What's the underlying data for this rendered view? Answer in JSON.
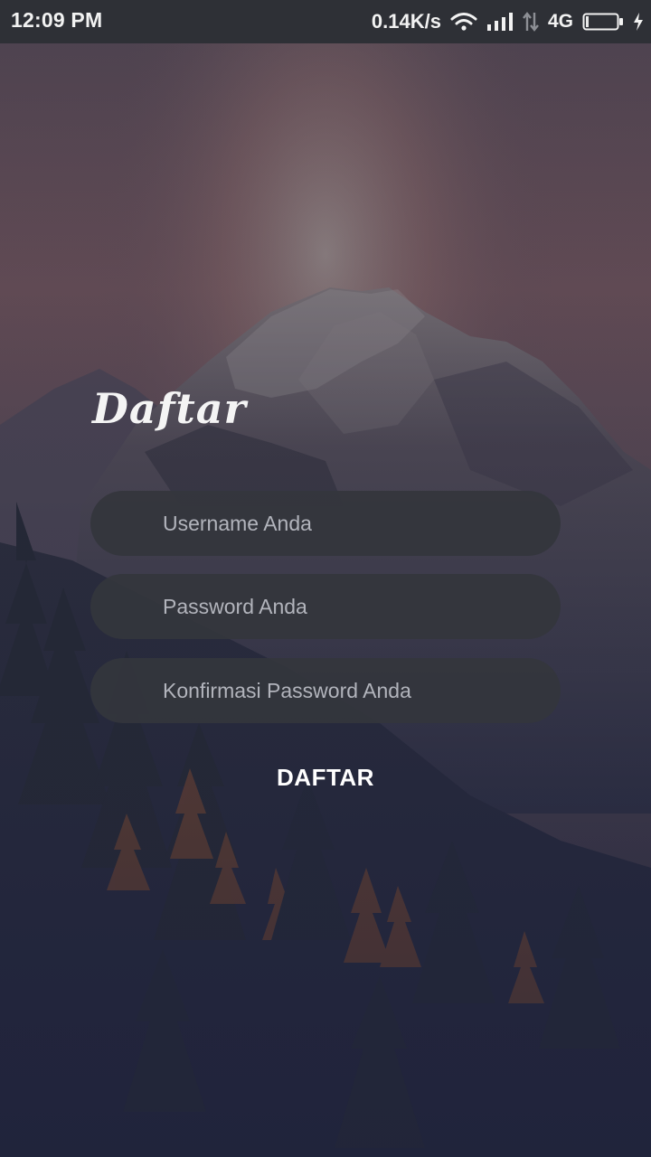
{
  "status_bar": {
    "time": "12:09 PM",
    "network_speed": "0.14K/s",
    "network_type": "4G",
    "icons": [
      "wifi-icon",
      "signal-icon",
      "data-transfer-icon",
      "battery-icon",
      "charging-icon"
    ]
  },
  "form": {
    "title": "Daftar",
    "username_placeholder": "Username Anda",
    "password_placeholder": "Password Anda",
    "confirm_password_placeholder": "Konfirmasi Password Anda",
    "submit_label": "DAFTAR"
  },
  "colors": {
    "status_bar_bg": "#2e3036",
    "field_bg": "#34363c",
    "placeholder_text": "#b2b4bc",
    "text_primary": "#ffffff",
    "scene_bottom": "#232841"
  }
}
